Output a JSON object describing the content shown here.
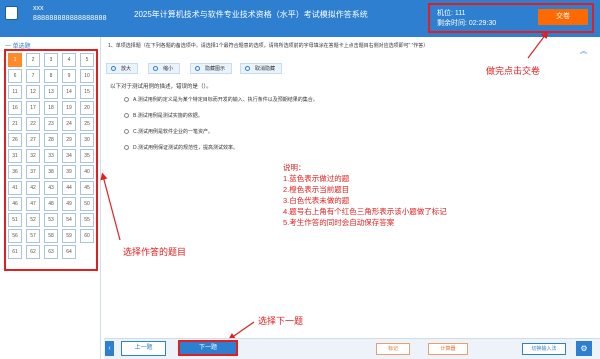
{
  "header": {
    "user_name": "xxx",
    "user_id": "888888888888888888",
    "exam_title": "2025年计算机技术与软件专业技术资格（水平）考试模拟作答系统",
    "seat_label": "机位:",
    "seat_value": "111",
    "timer_label": "剩余时间:",
    "timer_value": "02:29:30",
    "submit_label": "交卷"
  },
  "sidebar": {
    "section_label": "一 单选题",
    "questions": [
      {
        "n": "1",
        "status": "current"
      },
      {
        "n": "2"
      },
      {
        "n": "3"
      },
      {
        "n": "4"
      },
      {
        "n": "5"
      },
      {
        "n": "6"
      },
      {
        "n": "7"
      },
      {
        "n": "8"
      },
      {
        "n": "9"
      },
      {
        "n": "10"
      },
      {
        "n": "11"
      },
      {
        "n": "12"
      },
      {
        "n": "13"
      },
      {
        "n": "14"
      },
      {
        "n": "15"
      },
      {
        "n": "16"
      },
      {
        "n": "17"
      },
      {
        "n": "18"
      },
      {
        "n": "19"
      },
      {
        "n": "20"
      },
      {
        "n": "21"
      },
      {
        "n": "22"
      },
      {
        "n": "23"
      },
      {
        "n": "24"
      },
      {
        "n": "25"
      },
      {
        "n": "26"
      },
      {
        "n": "27"
      },
      {
        "n": "28"
      },
      {
        "n": "29"
      },
      {
        "n": "30"
      },
      {
        "n": "31"
      },
      {
        "n": "32"
      },
      {
        "n": "33"
      },
      {
        "n": "34"
      },
      {
        "n": "35"
      },
      {
        "n": "36"
      },
      {
        "n": "37"
      },
      {
        "n": "38"
      },
      {
        "n": "39"
      },
      {
        "n": "40"
      },
      {
        "n": "41"
      },
      {
        "n": "42"
      },
      {
        "n": "43"
      },
      {
        "n": "44"
      },
      {
        "n": "45"
      },
      {
        "n": "46"
      },
      {
        "n": "47"
      },
      {
        "n": "48"
      },
      {
        "n": "49"
      },
      {
        "n": "50"
      },
      {
        "n": "51"
      },
      {
        "n": "52"
      },
      {
        "n": "53"
      },
      {
        "n": "54"
      },
      {
        "n": "55"
      },
      {
        "n": "56"
      },
      {
        "n": "57"
      },
      {
        "n": "58"
      },
      {
        "n": "59"
      },
      {
        "n": "60"
      },
      {
        "n": "61"
      },
      {
        "n": "62"
      },
      {
        "n": "63"
      },
      {
        "n": "64"
      }
    ]
  },
  "question": {
    "header": "1、单项选择题（在下列各题的备选项中，请选择1个最符合题意的选项，请将所选项前的字母填涂在答题卡上点击题目右侧对应选项即可“ ”作答）",
    "toolbar": [
      "放大",
      "缩小",
      "隐藏图示",
      "取消隐藏"
    ],
    "stem": "以下对于测试用例的描述，错误的是（）。",
    "options": [
      "A.测试用例的定义是为某个特定目标而开发的输入、执行条件以及预期结果的集合。",
      "B.测试用例是测试实施的依据。",
      "C.测试用例是软件企业的一笔资产。",
      "D.测试用例保证测试的规范性，提高测试效率。"
    ]
  },
  "annotations": {
    "notes_title": "说明：",
    "notes": [
      "1.蓝色表示做过的题",
      "2.橙色表示当前题目",
      "3.白色代表未做的题",
      "4.题号右上角有个红色三角形表示该小题做了标记",
      "5.考生作答的同时会自动保存答案"
    ],
    "submit_hint": "做完点击交卷",
    "select_hint": "选择作答的题目",
    "next_hint": "选择下一题"
  },
  "bottom": {
    "prev_label": "上一题",
    "next_label": "下一题",
    "mark_label": "标记",
    "calc_label": "计算器",
    "enter_label": "切换输入法"
  },
  "colors": {
    "header_blue": "#2e7fd0",
    "submit_orange": "#ff6a00",
    "current_orange": "#ff8a2a",
    "annotation_red": "#e02020"
  }
}
